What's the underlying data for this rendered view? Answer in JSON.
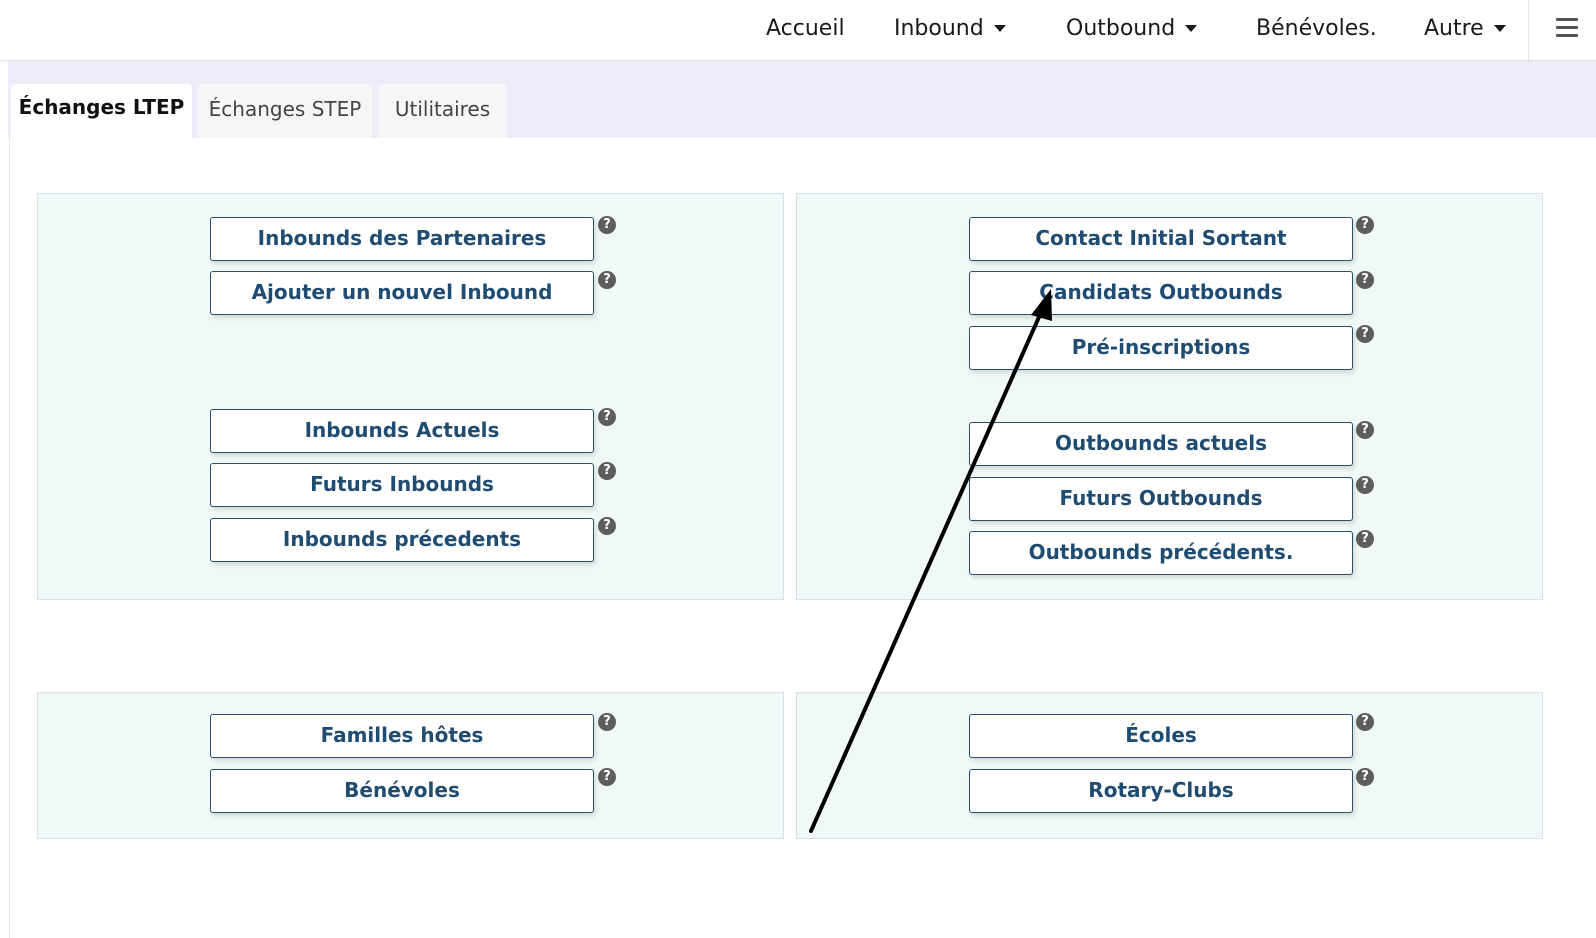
{
  "nav": {
    "home": "Accueil",
    "inbound": "Inbound",
    "outbound": "Outbound",
    "volunteers": "Bénévoles.",
    "other": "Autre",
    "menu_icon": "hamburger-icon"
  },
  "tabs": [
    "Échanges LTEP",
    "Échanges STEP",
    "Utilitaires"
  ],
  "active_tab": "Échanges LTEP",
  "help_glyph": "?",
  "panels": {
    "inbound_top": [
      "Inbounds des Partenaires",
      "Ajouter un nouvel Inbound"
    ],
    "inbound_bottom": [
      "Inbounds Actuels",
      "Futurs Inbounds",
      "Inbounds précedents"
    ],
    "outbound_top": [
      "Contact Initial Sortant",
      "Candidats Outbounds",
      "Pré-inscriptions"
    ],
    "outbound_bottom": [
      "Outbounds actuels",
      "Futurs Outbounds",
      "Outbounds précédents."
    ],
    "directory_left": [
      "Familles hôtes",
      "Bénévoles"
    ],
    "directory_right": [
      "Écoles",
      "Rotary-Clubs"
    ]
  },
  "colors": {
    "button_text": "#1f4c70",
    "button_border": "#2b4f6c",
    "panel_bg": "#f1f8f8",
    "tab_band": "#ecedf9",
    "help_icon": "#5d5d5d",
    "annotation_arrow": "#000000"
  }
}
